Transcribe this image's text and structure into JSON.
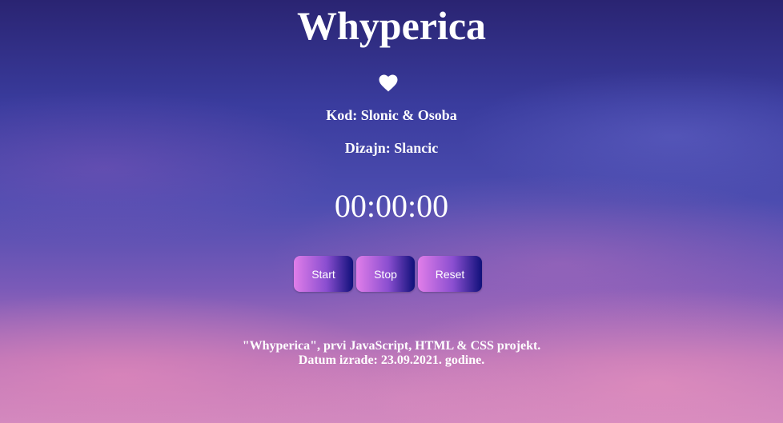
{
  "header": {
    "title": "Whyperica"
  },
  "credits": {
    "code": "Kod: Slonic & Osoba",
    "design": "Dizajn: Slancic"
  },
  "stopwatch": {
    "time": "00:00:00"
  },
  "controls": {
    "start_label": "Start",
    "stop_label": "Stop",
    "reset_label": "Reset"
  },
  "footer": {
    "line1": "\"Whyperica\", prvi JavaScript, HTML & CSS projekt.",
    "line2": "Datum izrade: 23.09.2021. godine."
  },
  "icons": {
    "heart": "heart-icon"
  },
  "colors": {
    "text": "#ffffff",
    "button_gradient_start": "#e17ee9",
    "button_gradient_end": "#10107a"
  }
}
